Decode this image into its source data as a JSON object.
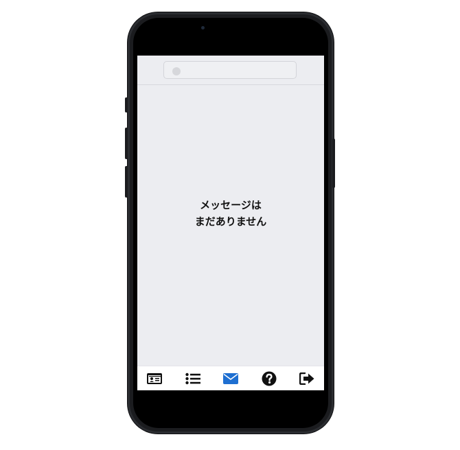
{
  "search": {
    "placeholder": ""
  },
  "empty_state": {
    "line1": "メッセージは",
    "line2": "まだありません"
  },
  "bottom_nav": {
    "items": [
      {
        "icon": "id-card-icon"
      },
      {
        "icon": "list-icon"
      },
      {
        "icon": "envelope-icon",
        "active": true
      },
      {
        "icon": "question-circle-icon"
      },
      {
        "icon": "sign-out-icon"
      }
    ],
    "active_color": "#1e6fd1",
    "default_color": "#111111"
  }
}
